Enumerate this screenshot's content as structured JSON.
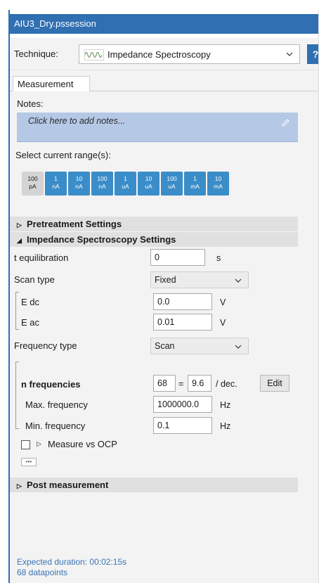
{
  "window": {
    "title": "AIU3_Dry.pssession"
  },
  "technique": {
    "label": "Technique:",
    "value": "Impedance Spectroscopy",
    "help_label": "?"
  },
  "tabs": [
    {
      "label": "Measurement"
    }
  ],
  "notes": {
    "label": "Notes:",
    "placeholder": "Click here to add notes..."
  },
  "current_range": {
    "label": "Select current range(s):",
    "ranges": [
      {
        "value": "100",
        "unit": "pA",
        "selected": false
      },
      {
        "value": "1",
        "unit": "nA",
        "selected": true
      },
      {
        "value": "10",
        "unit": "nA",
        "selected": true
      },
      {
        "value": "100",
        "unit": "nA",
        "selected": true
      },
      {
        "value": "1",
        "unit": "uA",
        "selected": true
      },
      {
        "value": "10",
        "unit": "uA",
        "selected": true
      },
      {
        "value": "100",
        "unit": "uA",
        "selected": true
      },
      {
        "value": "1",
        "unit": "mA",
        "selected": true
      },
      {
        "value": "10",
        "unit": "mA",
        "selected": true
      }
    ]
  },
  "sections": {
    "pretreatment": {
      "label": "Pretreatment Settings",
      "expanded": false
    },
    "impedance": {
      "label": "Impedance Spectroscopy Settings",
      "expanded": true
    },
    "post": {
      "label": "Post measurement",
      "expanded": false
    }
  },
  "settings": {
    "t_equilibration": {
      "label": "t equilibration",
      "value": "0",
      "unit": "s"
    },
    "scan_type": {
      "label": "Scan type",
      "value": "Fixed"
    },
    "e_dc": {
      "label": "E dc",
      "value": "0.0",
      "unit": "V"
    },
    "e_ac": {
      "label": "E ac",
      "value": "0.01",
      "unit": "V"
    },
    "frequency_type": {
      "label": "Frequency type",
      "value": "Scan"
    },
    "n_frequencies": {
      "label": "n frequencies",
      "value": "68",
      "equals": "=",
      "per_decade": "9.6",
      "per_decade_unit": "/ dec.",
      "edit_label": "Edit"
    },
    "max_frequency": {
      "label": "Max. frequency",
      "value": "1000000.0",
      "unit": "Hz"
    },
    "min_frequency": {
      "label": "Min. frequency",
      "value": "0.1",
      "unit": "Hz"
    },
    "measure_vs_ocp": {
      "label": "Measure vs OCP",
      "checked": false
    },
    "more_label": "•••"
  },
  "footer": {
    "duration": "Expected duration: 00:02:15s",
    "datapoints": "68 datapoints"
  },
  "colors": {
    "accent": "#2f6fb2",
    "range_selected": "#3a8dc8",
    "range_unselected": "#d4d4d4",
    "notes_bg": "#b5c8e6",
    "footer_text": "#3b74b5"
  }
}
